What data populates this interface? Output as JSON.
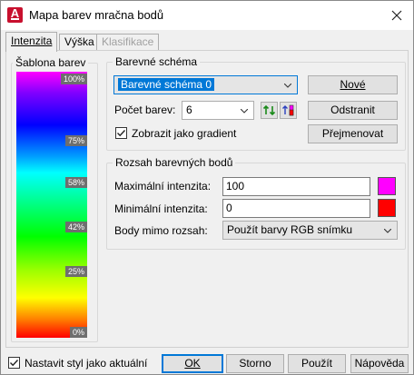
{
  "window": {
    "title": "Mapa barev mračna bodů",
    "app_icon": "autocad-icon",
    "close_icon": "close-icon"
  },
  "tabs": [
    {
      "label": "Intenzita",
      "state": "active"
    },
    {
      "label": "Výška",
      "state": "normal"
    },
    {
      "label": "Klasifikace",
      "state": "disabled"
    }
  ],
  "color_template": {
    "label": "Šablona barev",
    "stops": [
      "100%",
      "75%",
      "58%",
      "42%",
      "25%",
      "0%"
    ]
  },
  "color_scheme": {
    "group_label": "Barevné schéma",
    "scheme_value": "Barevné schéma 0",
    "count_label": "Počet barev:",
    "count_value": "6",
    "gradient_checkbox_label": "Zobrazit jako gradient",
    "gradient_checked": true,
    "new_button": "Nové",
    "delete_button": "Odstranit",
    "rename_button": "Přejmenovat",
    "sort_icon_1": "sort-ascending-icon",
    "sort_icon_2": "sort-descending-icon"
  },
  "range": {
    "group_label": "Rozsah barevných bodů",
    "max_label": "Maximální intenzita:",
    "max_value": "100",
    "max_color": "#ff00ff",
    "min_label": "Minimální intenzita:",
    "min_value": "0",
    "min_color": "#ff0000",
    "out_label": "Body mimo rozsah:",
    "out_value": "Použít barvy RGB snímku"
  },
  "footer": {
    "set_current_label": "Nastavit styl jako aktuální",
    "set_current_checked": true,
    "ok": "OK",
    "cancel": "Storno",
    "apply": "Použít",
    "help": "Nápověda"
  }
}
